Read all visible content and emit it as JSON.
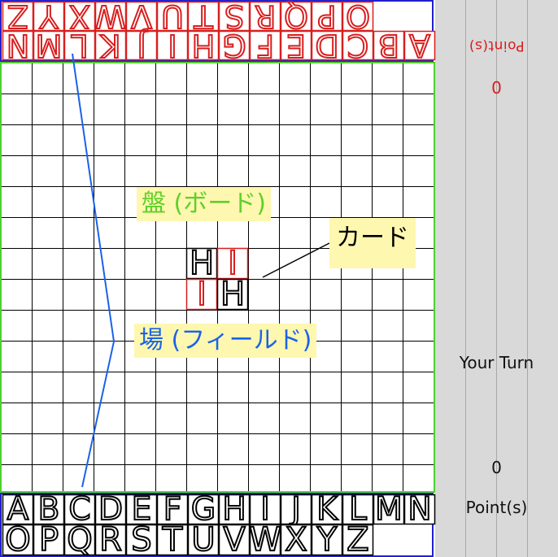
{
  "opponent": {
    "points_label": "Point(s)",
    "points": "0",
    "hand_rows": [
      [
        "Z",
        "Y",
        "X",
        "W",
        "V",
        "U",
        "T",
        "S",
        "R",
        "Q",
        "P",
        "O"
      ],
      [
        "N",
        "M",
        "L",
        "K",
        "J",
        "I",
        "H",
        "G",
        "F",
        "E",
        "D",
        "C",
        "B",
        "A"
      ]
    ]
  },
  "player": {
    "points_label": "Point(s)",
    "points": "0",
    "hand_rows": [
      [
        "A",
        "B",
        "C",
        "D",
        "E",
        "F",
        "G",
        "H",
        "I",
        "J",
        "K",
        "L",
        "M",
        "N"
      ],
      [
        "O",
        "P",
        "Q",
        "R",
        "S",
        "T",
        "U",
        "V",
        "W",
        "X",
        "Y",
        "Z"
      ]
    ]
  },
  "status": {
    "turn_label": "Your Turn"
  },
  "field": {
    "placed_cards": [
      {
        "letter": "H",
        "owner": "player"
      },
      {
        "letter": "I",
        "owner": "opponent"
      },
      {
        "letter": "I",
        "owner": "opponent"
      },
      {
        "letter": "H",
        "owner": "player"
      }
    ]
  },
  "annotations": {
    "board": "盤 (ボード)",
    "card": "カード",
    "field": "場 (フィールド)"
  },
  "colors": {
    "player": "#000000",
    "opponent": "#d81e1e",
    "hand_border": "#2020d0",
    "field_border": "#4fcf2f",
    "board_annotation": "#5fd02a",
    "field_annotation": "#1a62e8",
    "callout_bg": "#fdf7b0"
  }
}
